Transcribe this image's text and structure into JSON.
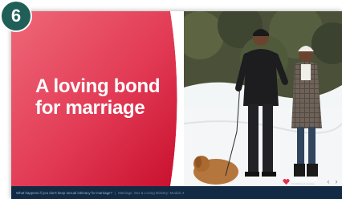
{
  "step": {
    "number": "6"
  },
  "slide": {
    "title": "A loving bond for marriage"
  },
  "footer": {
    "question": "What happens if you don't keep sexual intimacy for marriage?",
    "separator": "|",
    "course": "Marriage, Sex & Loving Ministry: Module 4"
  },
  "brand": {
    "name": "Lovewise",
    "tagline": "The Ministry of Lovewise"
  },
  "colors": {
    "badge": "#1f5f57",
    "panel_light": "#ec5a6c",
    "panel_dark": "#c8102e",
    "footer": "#132a44"
  },
  "icons": {
    "brand_logo": "heart-logo-icon",
    "prev": "chevron-left-icon",
    "next": "chevron-right-icon"
  },
  "nav": {
    "prev": "‹",
    "next": "›"
  }
}
